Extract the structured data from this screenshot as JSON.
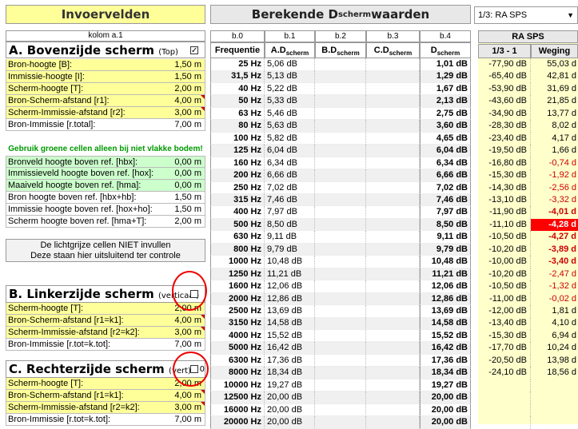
{
  "headers": {
    "invoer": "Invoervelden",
    "berekende_prefix": "Berekende D",
    "berekende_sub": "scherm",
    "berekende_suffix": " waarden",
    "dropdown_value": "1/3: RA SPS"
  },
  "kolom_label": "kolom a.1",
  "sectionA": {
    "title": "A. Bovenzijde scherm",
    "subtitle": "(Top)",
    "checked": "✓",
    "rows": [
      {
        "label": "Bron-hoogte [B]:",
        "value": "1,50 m"
      },
      {
        "label": "Immissie-hoogte [I]:",
        "value": "1,50 m"
      },
      {
        "label": "Scherm-hoogte [T]:",
        "value": "2,00 m"
      },
      {
        "label": "Bron-Scherm-afstand [r1]:",
        "value": "4,00 m"
      },
      {
        "label": "Scherm-Immissie-afstand [r2]:",
        "value": "3,00 m"
      },
      {
        "label": "Bron-Immissie [r.total]:",
        "value": "7,00 m"
      }
    ]
  },
  "green_note": "Gebruik groene cellen alleen bij niet vlakke bodem!",
  "green_rows": [
    {
      "label": "Bronveld hoogte boven ref. [hbx]:",
      "value": "0,00 m"
    },
    {
      "label": "Immissieveld hoogte boven ref. [hox]:",
      "value": "0,00 m"
    },
    {
      "label": "Maaiveld hoogte boven ref. [hma]:",
      "value": "0,00 m"
    }
  ],
  "derived_rows": [
    {
      "label": "Bron hoogte boven ref. [hbx+hb]:",
      "value": "1,50 m"
    },
    {
      "label": "Immissie hoogte boven ref. [hox+ho]:",
      "value": "1,50 m"
    },
    {
      "label": "Scherm hoogte boven ref. [hma+T]:",
      "value": "2,00 m"
    }
  ],
  "gray_note": {
    "line1": "De lichtgrijze cellen NIET invullen",
    "line2": "Deze staan hier uitsluitend ter controle"
  },
  "sectionB": {
    "title": "B. Linkerzijde scherm",
    "subtitle": "(verticaal)",
    "rows": [
      {
        "label": "Scherm-hoogte [T]:",
        "value": "2,00 m"
      },
      {
        "label": "Bron-Scherm-afstand [r1=k1]:",
        "value": "4,00 m"
      },
      {
        "label": "Scherm-Immissie-afstand [r2=k2]:",
        "value": "3,00 m"
      },
      {
        "label": "Bron-Immissie [r.tot=k.tot]:",
        "value": "7,00 m"
      }
    ]
  },
  "sectionC": {
    "title": "C. Rechterzijde scherm",
    "subtitle": "(vert)",
    "extra": "0",
    "rows": [
      {
        "label": "Scherm-hoogte [T]:",
        "value": "2,00 m"
      },
      {
        "label": "Bron-Scherm-afstand [r1=k1]:",
        "value": "4,00 m"
      },
      {
        "label": "Scherm-Immissie-afstand [r2=k2]:",
        "value": "3,00 m"
      },
      {
        "label": "Bron-Immissie [r.tot=k.tot]:",
        "value": "7,00 m"
      }
    ]
  },
  "table": {
    "col_ids": [
      "b.0",
      "b.1",
      "b.2",
      "b.3",
      "b.4"
    ],
    "col_heads": [
      {
        "main": "Frequentie",
        "sub": ""
      },
      {
        "main": "A.D",
        "sub": "scherm"
      },
      {
        "main": "B.D",
        "sub": "scherm"
      },
      {
        "main": "C.D",
        "sub": "scherm"
      },
      {
        "main": "D",
        "sub": "scherm"
      }
    ],
    "rows": [
      [
        "25 Hz",
        "5,06 dB",
        "",
        "",
        "1,01 dB"
      ],
      [
        "31,5 Hz",
        "5,13 dB",
        "",
        "",
        "1,29 dB"
      ],
      [
        "40 Hz",
        "5,22 dB",
        "",
        "",
        "1,67 dB"
      ],
      [
        "50 Hz",
        "5,33 dB",
        "",
        "",
        "2,13 dB"
      ],
      [
        "63 Hz",
        "5,46 dB",
        "",
        "",
        "2,75 dB"
      ],
      [
        "80 Hz",
        "5,63 dB",
        "",
        "",
        "3,60 dB"
      ],
      [
        "100 Hz",
        "5,82 dB",
        "",
        "",
        "4,65 dB"
      ],
      [
        "125 Hz",
        "6,04 dB",
        "",
        "",
        "6,04 dB"
      ],
      [
        "160 Hz",
        "6,34 dB",
        "",
        "",
        "6,34 dB"
      ],
      [
        "200 Hz",
        "6,66 dB",
        "",
        "",
        "6,66 dB"
      ],
      [
        "250 Hz",
        "7,02 dB",
        "",
        "",
        "7,02 dB"
      ],
      [
        "315 Hz",
        "7,46 dB",
        "",
        "",
        "7,46 dB"
      ],
      [
        "400 Hz",
        "7,97 dB",
        "",
        "",
        "7,97 dB"
      ],
      [
        "500 Hz",
        "8,50 dB",
        "",
        "",
        "8,50 dB"
      ],
      [
        "630 Hz",
        "9,11 dB",
        "",
        "",
        "9,11 dB"
      ],
      [
        "800 Hz",
        "9,79 dB",
        "",
        "",
        "9,79 dB"
      ],
      [
        "1000 Hz",
        "10,48 dB",
        "",
        "",
        "10,48 dB"
      ],
      [
        "1250 Hz",
        "11,21 dB",
        "",
        "",
        "11,21 dB"
      ],
      [
        "1600 Hz",
        "12,06 dB",
        "",
        "",
        "12,06 dB"
      ],
      [
        "2000 Hz",
        "12,86 dB",
        "",
        "",
        "12,86 dB"
      ],
      [
        "2500 Hz",
        "13,69 dB",
        "",
        "",
        "13,69 dB"
      ],
      [
        "3150 Hz",
        "14,58 dB",
        "",
        "",
        "14,58 dB"
      ],
      [
        "4000 Hz",
        "15,52 dB",
        "",
        "",
        "15,52 dB"
      ],
      [
        "5000 Hz",
        "16,42 dB",
        "",
        "",
        "16,42 dB"
      ],
      [
        "6300 Hz",
        "17,36 dB",
        "",
        "",
        "17,36 dB"
      ],
      [
        "8000 Hz",
        "18,34 dB",
        "",
        "",
        "18,34 dB"
      ],
      [
        "10000 Hz",
        "19,27 dB",
        "",
        "",
        "19,27 dB"
      ],
      [
        "12500 Hz",
        "20,00 dB",
        "",
        "",
        "20,00 dB"
      ],
      [
        "16000 Hz",
        "20,00 dB",
        "",
        "",
        "20,00 dB"
      ],
      [
        "20000 Hz",
        "20,00 dB",
        "",
        "",
        "20,00 dB"
      ]
    ]
  },
  "ra": {
    "title": "RA SPS",
    "col1": "1/3  -  1",
    "col2": "Weging",
    "rows": [
      [
        "-77,90 dB",
        "55,03 d"
      ],
      [
        "-65,40 dB",
        "42,81 d"
      ],
      [
        "-53,90 dB",
        "31,69 d"
      ],
      [
        "-43,60 dB",
        "21,85 d"
      ],
      [
        "-34,90 dB",
        "13,77 d"
      ],
      [
        "-28,30 dB",
        "8,02 d"
      ],
      [
        "-23,40 dB",
        "4,17 d"
      ],
      [
        "-19,50 dB",
        "1,66 d"
      ],
      [
        "-16,80 dB",
        "-0,74 d"
      ],
      [
        "-15,30 dB",
        "-1,92 d"
      ],
      [
        "-14,30 dB",
        "-2,56 d"
      ],
      [
        "-13,10 dB",
        "-3,32 d"
      ],
      [
        "-11,90 dB",
        "-4,01 d"
      ],
      [
        "-11,10 dB",
        "-4,28 d"
      ],
      [
        "-10,50 dB",
        "-4,27 d"
      ],
      [
        "-10,20 dB",
        "-3,89 d"
      ],
      [
        "-10,00 dB",
        "-3,40 d"
      ],
      [
        "-10,20 dB",
        "-2,47 d"
      ],
      [
        "-10,50 dB",
        "-1,32 d"
      ],
      [
        "-11,00 dB",
        "-0,02 d"
      ],
      [
        "-12,00 dB",
        "1,81 d"
      ],
      [
        "-13,40 dB",
        "4,10 d"
      ],
      [
        "-15,30 dB",
        "6,94 d"
      ],
      [
        "-17,70 dB",
        "10,24 d"
      ],
      [
        "-20,50 dB",
        "13,98 d"
      ],
      [
        "-24,10 dB",
        "18,56 d"
      ],
      [
        "",
        ""
      ],
      [
        "",
        ""
      ],
      [
        "",
        ""
      ],
      [
        "",
        ""
      ]
    ],
    "colors": {
      "neg": "#cc0000",
      "highlight_bg": "#ff0000",
      "highlight_fg": "#ffffff"
    }
  }
}
